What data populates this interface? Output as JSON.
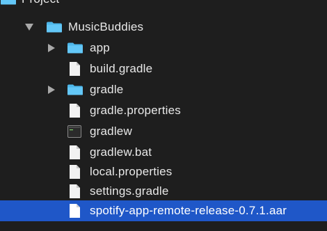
{
  "tree": {
    "items": [
      {
        "label": "Project",
        "kind": "folder",
        "icon": "folder-icon"
      },
      {
        "label": "MusicBuddies",
        "kind": "folder",
        "icon": "folder-icon",
        "expanded": true
      },
      {
        "label": "app",
        "kind": "folder",
        "icon": "folder-icon",
        "expanded": false
      },
      {
        "label": "build.gradle",
        "kind": "file",
        "icon": "file-icon"
      },
      {
        "label": "gradle",
        "kind": "folder",
        "icon": "folder-icon",
        "expanded": false
      },
      {
        "label": "gradle.properties",
        "kind": "file",
        "icon": "file-icon"
      },
      {
        "label": "gradlew",
        "kind": "executable",
        "icon": "terminal-executable-icon"
      },
      {
        "label": "gradlew.bat",
        "kind": "file",
        "icon": "file-icon"
      },
      {
        "label": "local.properties",
        "kind": "file",
        "icon": "file-icon"
      },
      {
        "label": "settings.gradle",
        "kind": "file",
        "icon": "file-icon"
      },
      {
        "label": "spotify-app-remote-release-0.7.1.aar",
        "kind": "file",
        "icon": "file-icon",
        "selected": true
      }
    ]
  },
  "colors": {
    "background": "#1e1e1e",
    "selection": "#1f57c8",
    "folder": "#5ac8fa",
    "text": "#e8e8e8"
  }
}
